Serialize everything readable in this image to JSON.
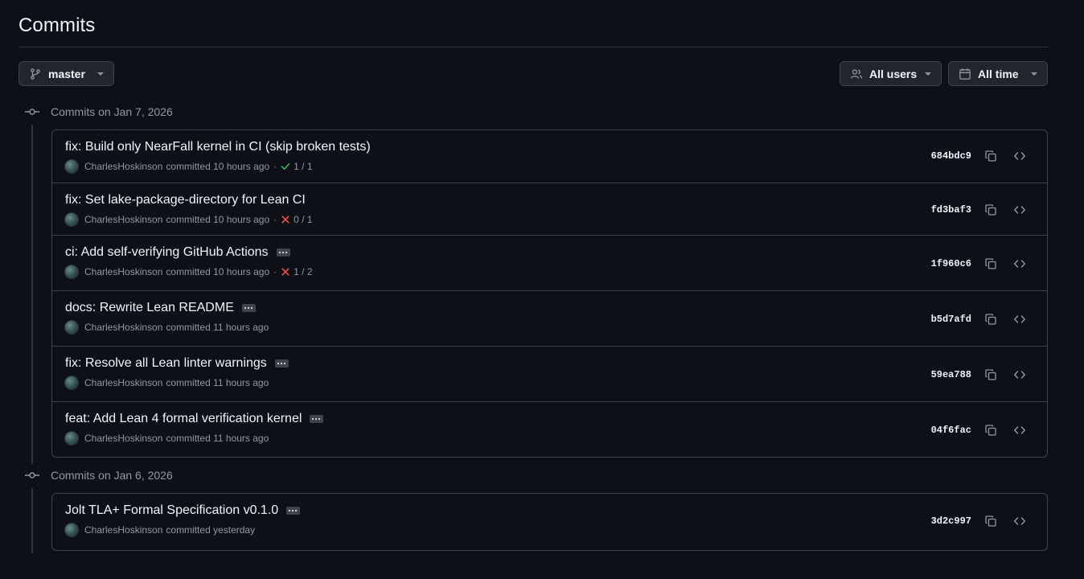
{
  "header": {
    "title": "Commits"
  },
  "filters": {
    "branch": "master",
    "users": "All users",
    "time": "All time"
  },
  "groups": [
    {
      "label": "Commits on Jan 7, 2026",
      "commits": [
        {
          "message": "fix: Build only NearFall kernel in CI (skip broken tests)",
          "author": "CharlesHoskinson",
          "committed": "committed 10 hours ago",
          "status": "1 / 1",
          "status_kind": "success",
          "hash": "684bdc9",
          "has_more": false
        },
        {
          "message": "fix: Set lake-package-directory for Lean CI",
          "author": "CharlesHoskinson",
          "committed": "committed 10 hours ago",
          "status": "0 / 1",
          "status_kind": "failure",
          "hash": "fd3baf3",
          "has_more": false
        },
        {
          "message": "ci: Add self-verifying GitHub Actions",
          "author": "CharlesHoskinson",
          "committed": "committed 10 hours ago",
          "status": "1 / 2",
          "status_kind": "failure",
          "hash": "1f960c6",
          "has_more": true
        },
        {
          "message": "docs: Rewrite Lean README",
          "author": "CharlesHoskinson",
          "committed": "committed 11 hours ago",
          "status": "",
          "status_kind": "",
          "hash": "b5d7afd",
          "has_more": true
        },
        {
          "message": "fix: Resolve all Lean linter warnings",
          "author": "CharlesHoskinson",
          "committed": "committed 11 hours ago",
          "status": "",
          "status_kind": "",
          "hash": "59ea788",
          "has_more": true
        },
        {
          "message": "feat: Add Lean 4 formal verification kernel",
          "author": "CharlesHoskinson",
          "committed": "committed 11 hours ago",
          "status": "",
          "status_kind": "",
          "hash": "04f6fac",
          "has_more": true
        }
      ]
    },
    {
      "label": "Commits on Jan 6, 2026",
      "commits": [
        {
          "message": "Jolt TLA+ Formal Specification v0.1.0",
          "author": "CharlesHoskinson",
          "committed": "committed yesterday",
          "status": "",
          "status_kind": "",
          "hash": "3d2c997",
          "has_more": true
        }
      ]
    }
  ],
  "colors": {
    "background": "#0d1117",
    "border": "#3d444d",
    "text": "#f0f6fc",
    "muted": "#9198a1",
    "success": "#3fb950",
    "failure": "#f85149"
  },
  "icons": {
    "branch": "git-branch-icon",
    "users": "people-icon",
    "time": "calendar-icon",
    "group": "git-commit-icon",
    "copy": "copy-icon",
    "browse": "code-icon",
    "success": "check-icon",
    "failure": "x-icon",
    "more": "ellipsis-icon"
  }
}
